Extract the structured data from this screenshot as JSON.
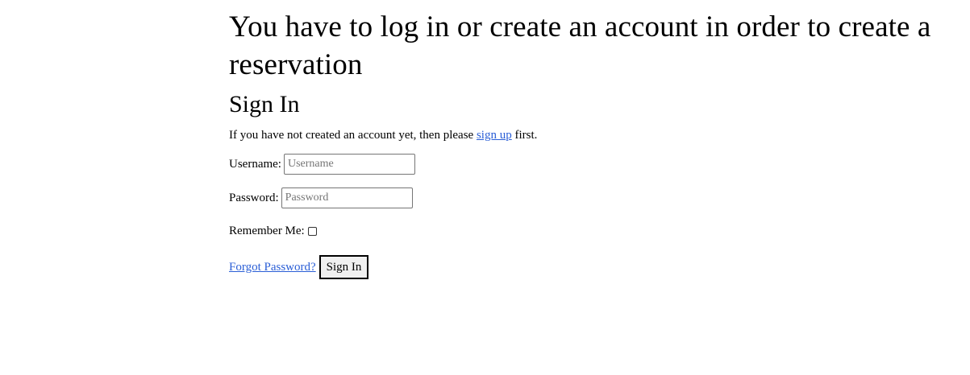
{
  "headline": "You have to log in or create an account in order to create a reservation",
  "signin": {
    "title": "Sign In",
    "intro_before": "If you have not created an account yet, then please ",
    "signup_link": "sign up",
    "intro_after": " first."
  },
  "form": {
    "username_label": "Username:",
    "username_placeholder": "Username",
    "username_value": "",
    "password_label": "Password:",
    "password_placeholder": "Password",
    "password_value": "",
    "remember_label": "Remember Me:",
    "remember_checked": false,
    "forgot_link": "Forgot Password?",
    "submit_label": "Sign In"
  },
  "colors": {
    "link": "#2a5ed6",
    "text": "#000000",
    "background": "#ffffff"
  }
}
